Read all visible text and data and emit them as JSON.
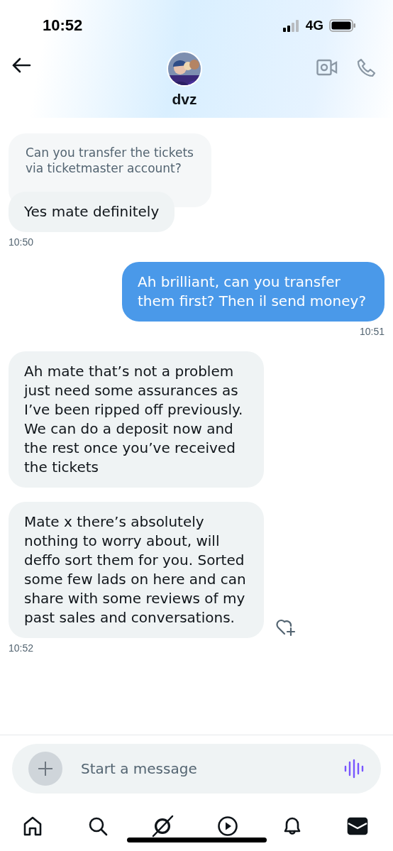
{
  "status_bar": {
    "time": "10:52",
    "network": "4G"
  },
  "header": {
    "name": "dvz"
  },
  "messages": [
    {
      "kind": "received",
      "quote": "Can you transfer the tickets via ticketmaster account?",
      "text": "Yes mate definitely",
      "time": "10:50",
      "react": false
    },
    {
      "kind": "sent",
      "text": "Ah brilliant, can you transfer them first? Then il send money?",
      "time": "10:51",
      "react": false
    },
    {
      "kind": "received",
      "text": "Ah mate that’s not a problem just need some assurances as I’ve been ripped off previously. We can do a deposit now and the rest once you’ve received the tickets",
      "react": false
    },
    {
      "kind": "received",
      "text": "Mate x there’s absolutely nothing to worry about, will deffo sort them for you. Sorted some few lads on here and can share with some reviews of my past sales and conversations.",
      "time": "10:52",
      "react": true
    }
  ],
  "composer": {
    "placeholder": "Start a message"
  },
  "nav": [
    {
      "kind": "home",
      "selected": false
    },
    {
      "kind": "search",
      "selected": false
    },
    {
      "kind": "grok",
      "selected": false
    },
    {
      "kind": "video",
      "selected": false
    },
    {
      "kind": "notifications",
      "selected": false
    },
    {
      "kind": "messages",
      "selected": true
    }
  ]
}
